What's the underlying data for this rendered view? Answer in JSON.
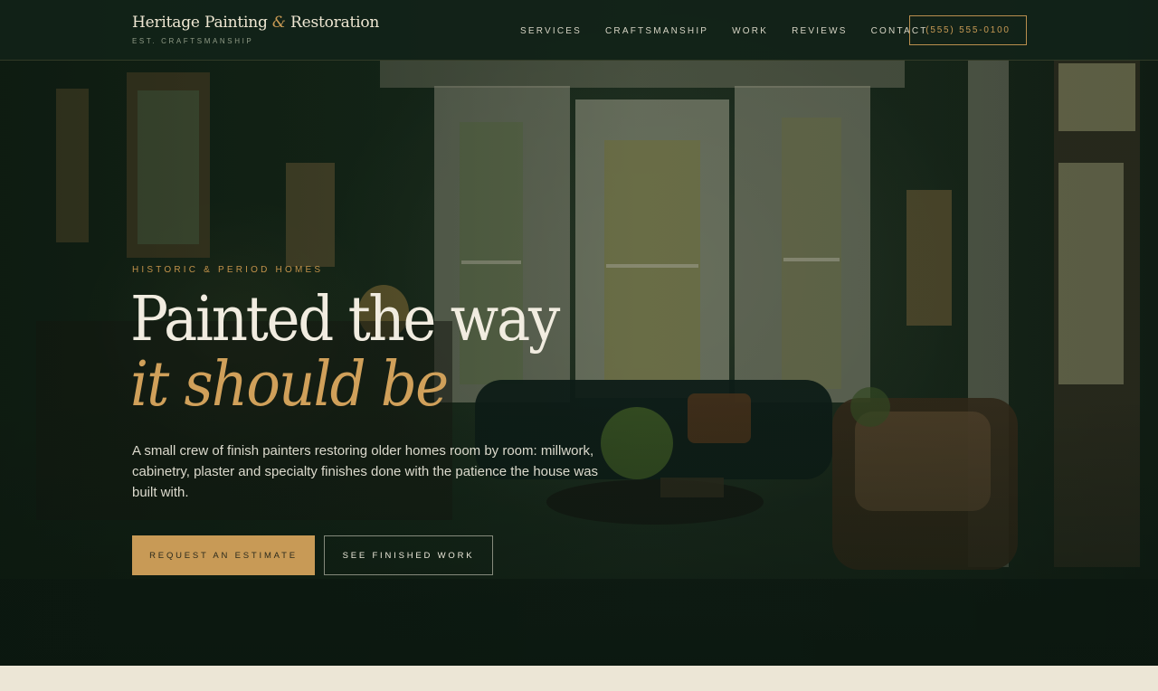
{
  "header": {
    "brand_name_part1": "Heritage Painting ",
    "brand_amp": "&",
    "brand_name_part2": " Restoration",
    "brand_tagline": "EST. CRAFTSMANSHIP",
    "nav": [
      "SERVICES",
      "CRAFTSMANSHIP",
      "WORK",
      "REVIEWS",
      "CONTACT"
    ],
    "phone": "(555) 555-0100"
  },
  "hero": {
    "eyebrow": "HISTORIC & PERIOD HOMES",
    "headline_line1": "Painted the way",
    "headline_line2": "it should be",
    "lede": "A small crew of finish painters restoring older homes room by room: millwork, cabinetry, plaster and specialty finishes done with the patience the house was built with.",
    "cta_primary": "REQUEST AN ESTIMATE",
    "cta_secondary": "SEE FINISHED WORK"
  },
  "colors": {
    "accent": "#c89a56",
    "header_bg": "#122218",
    "page_bg": "#ece6d6"
  }
}
